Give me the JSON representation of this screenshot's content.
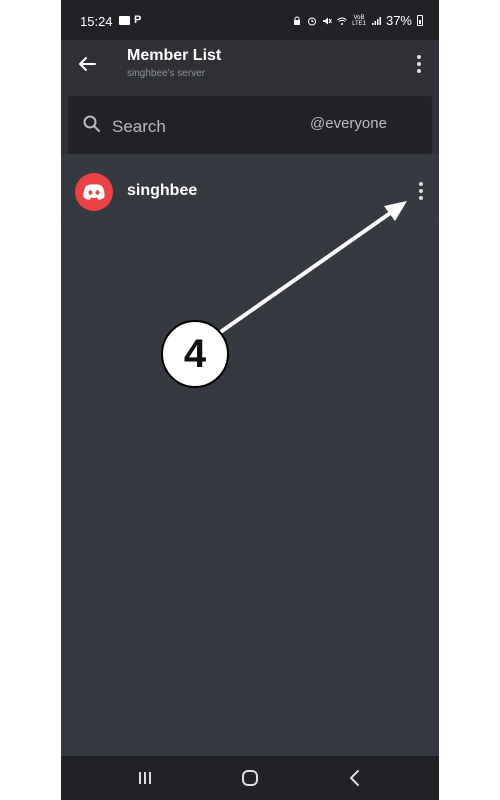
{
  "status_bar": {
    "time": "15:24",
    "network": "VoB\nLTE1",
    "battery": "37%"
  },
  "header": {
    "title": "Member List",
    "subtitle": "singhbee's server",
    "back_icon": "arrow-left-icon",
    "menu_icon": "kebab-menu-icon"
  },
  "search": {
    "placeholder": "Search",
    "filter": "@everyone",
    "icon": "search-icon"
  },
  "members": [
    {
      "name": "singhbee",
      "avatar_icon": "discord-logo-icon",
      "avatar_color": "#ed4245"
    }
  ],
  "annotation": {
    "step": "4"
  },
  "nav": {
    "recents_icon": "recents-icon",
    "home_icon": "home-icon",
    "back_icon": "back-chevron-icon"
  },
  "colors": {
    "background": "#36393f",
    "header": "#2f3136",
    "search": "#202225",
    "text": "#ffffff",
    "muted": "#8e9297"
  }
}
